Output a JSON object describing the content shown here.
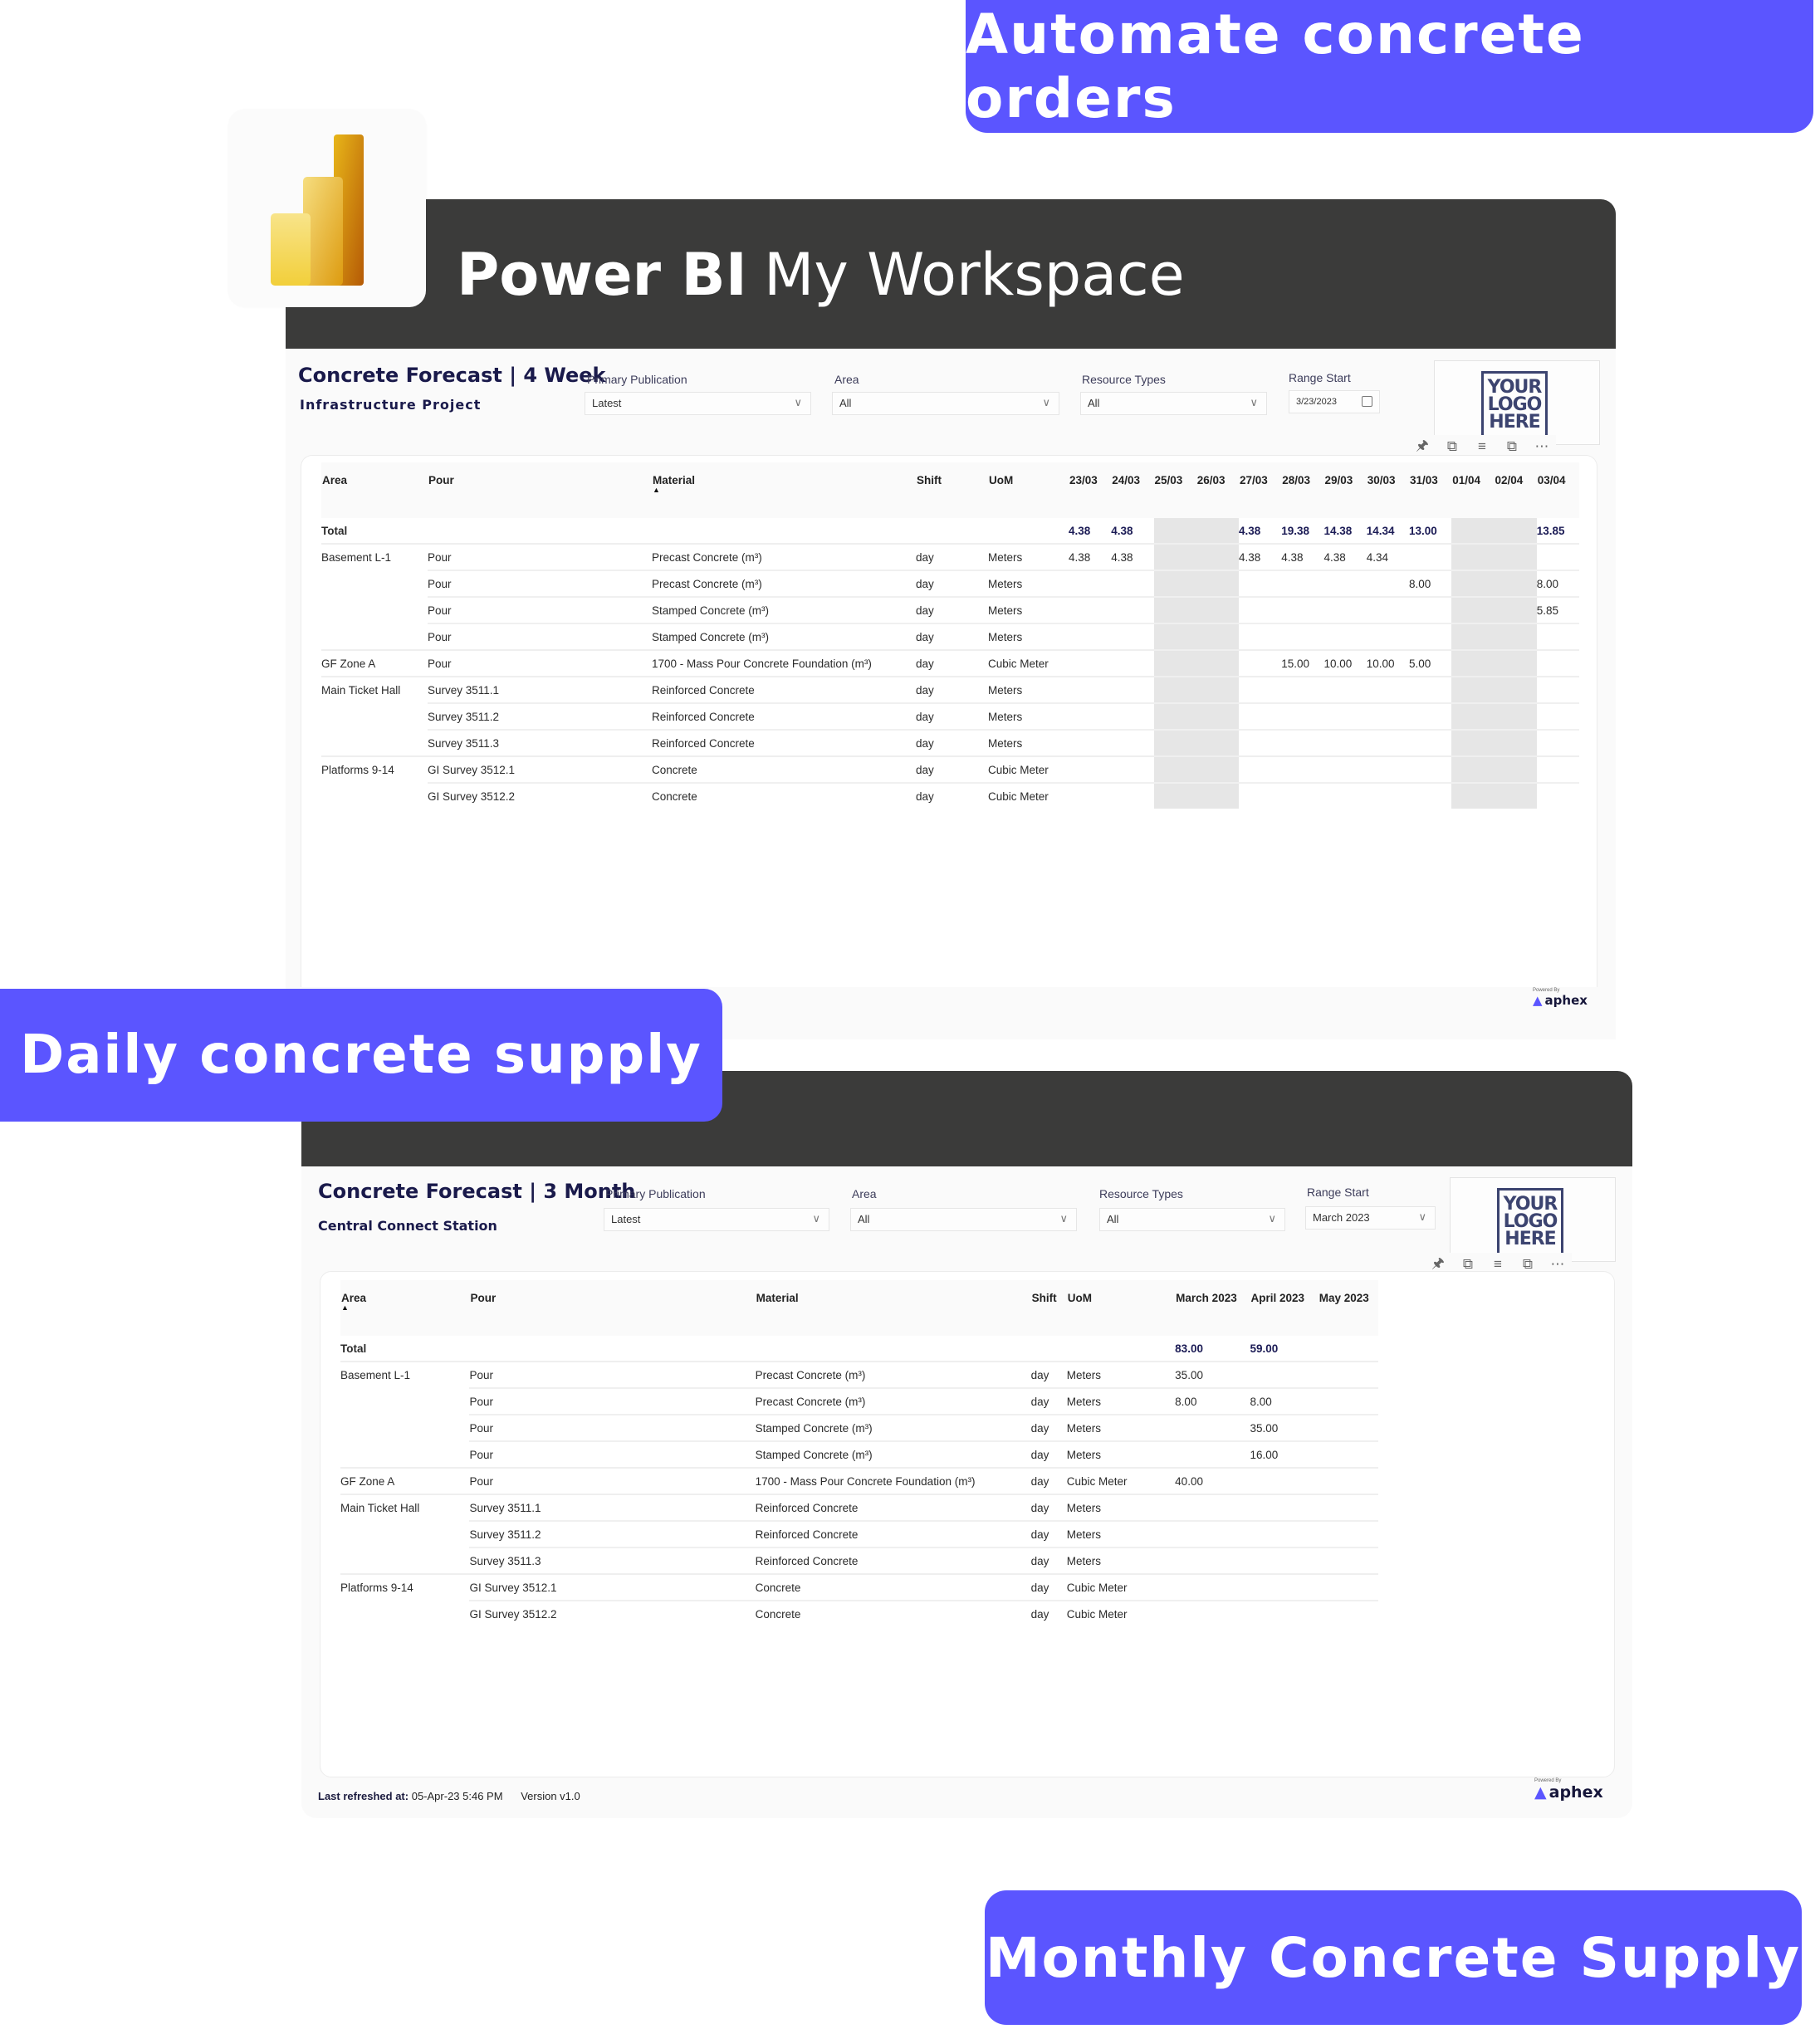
{
  "badges": {
    "top": "Automate concrete orders",
    "daily": "Daily concrete supply",
    "monthly": "Monthly Concrete Supply"
  },
  "colors": {
    "accent": "#5b55ff",
    "header_bar": "#3b3b3a",
    "title_navy": "#1a1a4b",
    "weekend_shade": "#e6e6e6"
  },
  "app": {
    "name": "Power BI",
    "workspace": "My Workspace",
    "logo_icon": "powerbi-logo-icon"
  },
  "reports": [
    {
      "title": "Concrete Forecast | 4 Week",
      "subtitle": "Infrastructure Project",
      "filters": [
        {
          "label": "Primary Publication",
          "value": "Latest",
          "icon": "chevron-down-icon"
        },
        {
          "label": "Area",
          "value": "All",
          "icon": "chevron-down-icon"
        },
        {
          "label": "Resource Types",
          "value": "All",
          "icon": "chevron-down-icon"
        },
        {
          "label": "Range Start",
          "value": "3/23/2023",
          "icon": "calendar-icon"
        }
      ],
      "logo_text": [
        "YOUR",
        "LOGO",
        "HERE"
      ],
      "visual_tools": [
        "pin-icon",
        "copy-icon",
        "filter-icon",
        "focus-mode-icon",
        "more-options-icon"
      ],
      "table": {
        "columns": [
          "Area",
          "Pour",
          "Material",
          "Shift",
          "UoM",
          "23/03",
          "24/03",
          "25/03",
          "26/03",
          "27/03",
          "28/03",
          "29/03",
          "30/03",
          "31/03",
          "01/04",
          "02/04",
          "03/04"
        ],
        "sorted_column": "Material",
        "weekend_columns": [
          "25/03",
          "26/03",
          "01/04",
          "02/04"
        ],
        "total": {
          "label": "Total",
          "values": [
            "4.38",
            "4.38",
            "",
            "",
            "4.38",
            "19.38",
            "14.38",
            "14.34",
            "13.00",
            "",
            "",
            "13.85"
          ]
        },
        "rows": [
          {
            "area": "Basement L-1",
            "pour": "Pour",
            "material": "Precast Concrete (m³)",
            "shift": "day",
            "uom": "Meters",
            "values": [
              "4.38",
              "4.38",
              "",
              "",
              "4.38",
              "4.38",
              "4.38",
              "4.34",
              "",
              "",
              "",
              ""
            ]
          },
          {
            "area": "",
            "pour": "Pour",
            "material": "Precast Concrete (m³)",
            "shift": "day",
            "uom": "Meters",
            "values": [
              "",
              "",
              "",
              "",
              "",
              "",
              "",
              "",
              "8.00",
              "",
              "",
              "8.00"
            ]
          },
          {
            "area": "",
            "pour": "Pour",
            "material": "Stamped Concrete (m³)",
            "shift": "day",
            "uom": "Meters",
            "values": [
              "",
              "",
              "",
              "",
              "",
              "",
              "",
              "",
              "",
              "",
              "",
              "5.85"
            ]
          },
          {
            "area": "",
            "pour": "Pour",
            "material": "Stamped Concrete (m³)",
            "shift": "day",
            "uom": "Meters",
            "values": [
              "",
              "",
              "",
              "",
              "",
              "",
              "",
              "",
              "",
              "",
              "",
              ""
            ]
          },
          {
            "area": "GF Zone A",
            "pour": "Pour",
            "material": "1700 - Mass Pour Concrete Foundation (m³)",
            "shift": "day",
            "uom": "Cubic Meter",
            "values": [
              "",
              "",
              "",
              "",
              "",
              "15.00",
              "10.00",
              "10.00",
              "5.00",
              "",
              "",
              ""
            ]
          },
          {
            "area": "Main Ticket Hall",
            "pour": "Survey 3511.1",
            "material": "Reinforced Concrete",
            "shift": "day",
            "uom": "Meters",
            "values": [
              "",
              "",
              "",
              "",
              "",
              "",
              "",
              "",
              "",
              "",
              "",
              ""
            ]
          },
          {
            "area": "",
            "pour": "Survey 3511.2",
            "material": "Reinforced Concrete",
            "shift": "day",
            "uom": "Meters",
            "values": [
              "",
              "",
              "",
              "",
              "",
              "",
              "",
              "",
              "",
              "",
              "",
              ""
            ]
          },
          {
            "area": "",
            "pour": "Survey 3511.3",
            "material": "Reinforced Concrete",
            "shift": "day",
            "uom": "Meters",
            "values": [
              "",
              "",
              "",
              "",
              "",
              "",
              "",
              "",
              "",
              "",
              "",
              ""
            ]
          },
          {
            "area": "Platforms 9-14",
            "pour": "GI Survey 3512.1",
            "material": "Concrete",
            "shift": "day",
            "uom": "Cubic Meter",
            "values": [
              "",
              "",
              "",
              "",
              "",
              "",
              "",
              "",
              "",
              "",
              "",
              ""
            ]
          },
          {
            "area": "",
            "pour": "GI Survey 3512.2",
            "material": "Concrete",
            "shift": "day",
            "uom": "Cubic Meter",
            "values": [
              "",
              "",
              "",
              "",
              "",
              "",
              "",
              "",
              "",
              "",
              "",
              ""
            ]
          }
        ]
      },
      "footer": {
        "powered_by": "Powered By",
        "brand": "aphex"
      }
    },
    {
      "title": "Concrete Forecast | 3 Month",
      "subtitle": "Central Connect Station",
      "filters": [
        {
          "label": "Primary Publication",
          "value": "Latest",
          "icon": "chevron-down-icon"
        },
        {
          "label": "Area",
          "value": "All",
          "icon": "chevron-down-icon"
        },
        {
          "label": "Resource Types",
          "value": "All",
          "icon": "chevron-down-icon"
        },
        {
          "label": "Range Start",
          "value": "March 2023",
          "icon": "chevron-down-icon"
        }
      ],
      "logo_text": [
        "YOUR",
        "LOGO",
        "HERE"
      ],
      "visual_tools": [
        "pin-icon",
        "copy-icon",
        "filter-icon",
        "focus-mode-icon",
        "more-options-icon"
      ],
      "table": {
        "columns": [
          "Area",
          "Pour",
          "Material",
          "Shift",
          "UoM",
          "March 2023",
          "April 2023",
          "May 2023"
        ],
        "sorted_column": "Area",
        "total": {
          "label": "Total",
          "values": [
            "83.00",
            "59.00",
            ""
          ]
        },
        "rows": [
          {
            "area": "Basement L-1",
            "pour": "Pour",
            "material": "Precast Concrete (m³)",
            "shift": "day",
            "uom": "Meters",
            "values": [
              "35.00",
              "",
              ""
            ]
          },
          {
            "area": "",
            "pour": "Pour",
            "material": "Precast Concrete (m³)",
            "shift": "day",
            "uom": "Meters",
            "values": [
              "8.00",
              "8.00",
              ""
            ]
          },
          {
            "area": "",
            "pour": "Pour",
            "material": "Stamped Concrete (m³)",
            "shift": "day",
            "uom": "Meters",
            "values": [
              "",
              "35.00",
              ""
            ]
          },
          {
            "area": "",
            "pour": "Pour",
            "material": "Stamped Concrete (m³)",
            "shift": "day",
            "uom": "Meters",
            "values": [
              "",
              "16.00",
              ""
            ]
          },
          {
            "area": "GF Zone A",
            "pour": "Pour",
            "material": "1700 - Mass Pour Concrete Foundation (m³)",
            "shift": "day",
            "uom": "Cubic Meter",
            "values": [
              "40.00",
              "",
              ""
            ]
          },
          {
            "area": "Main Ticket Hall",
            "pour": "Survey 3511.1",
            "material": "Reinforced Concrete",
            "shift": "day",
            "uom": "Meters",
            "values": [
              "",
              "",
              ""
            ]
          },
          {
            "area": "",
            "pour": "Survey 3511.2",
            "material": "Reinforced Concrete",
            "shift": "day",
            "uom": "Meters",
            "values": [
              "",
              "",
              ""
            ]
          },
          {
            "area": "",
            "pour": "Survey 3511.3",
            "material": "Reinforced Concrete",
            "shift": "day",
            "uom": "Meters",
            "values": [
              "",
              "",
              ""
            ]
          },
          {
            "area": "Platforms 9-14",
            "pour": "GI Survey 3512.1",
            "material": "Concrete",
            "shift": "day",
            "uom": "Cubic Meter",
            "values": [
              "",
              "",
              ""
            ]
          },
          {
            "area": "",
            "pour": "GI Survey 3512.2",
            "material": "Concrete",
            "shift": "day",
            "uom": "Cubic Meter",
            "values": [
              "",
              "",
              ""
            ]
          }
        ]
      },
      "footer": {
        "refreshed_label": "Last refreshed at:",
        "refreshed_value": "05-Apr-23 5:46 PM",
        "version": "Version v1.0",
        "powered_by": "Powered By",
        "brand": "aphex"
      }
    }
  ]
}
